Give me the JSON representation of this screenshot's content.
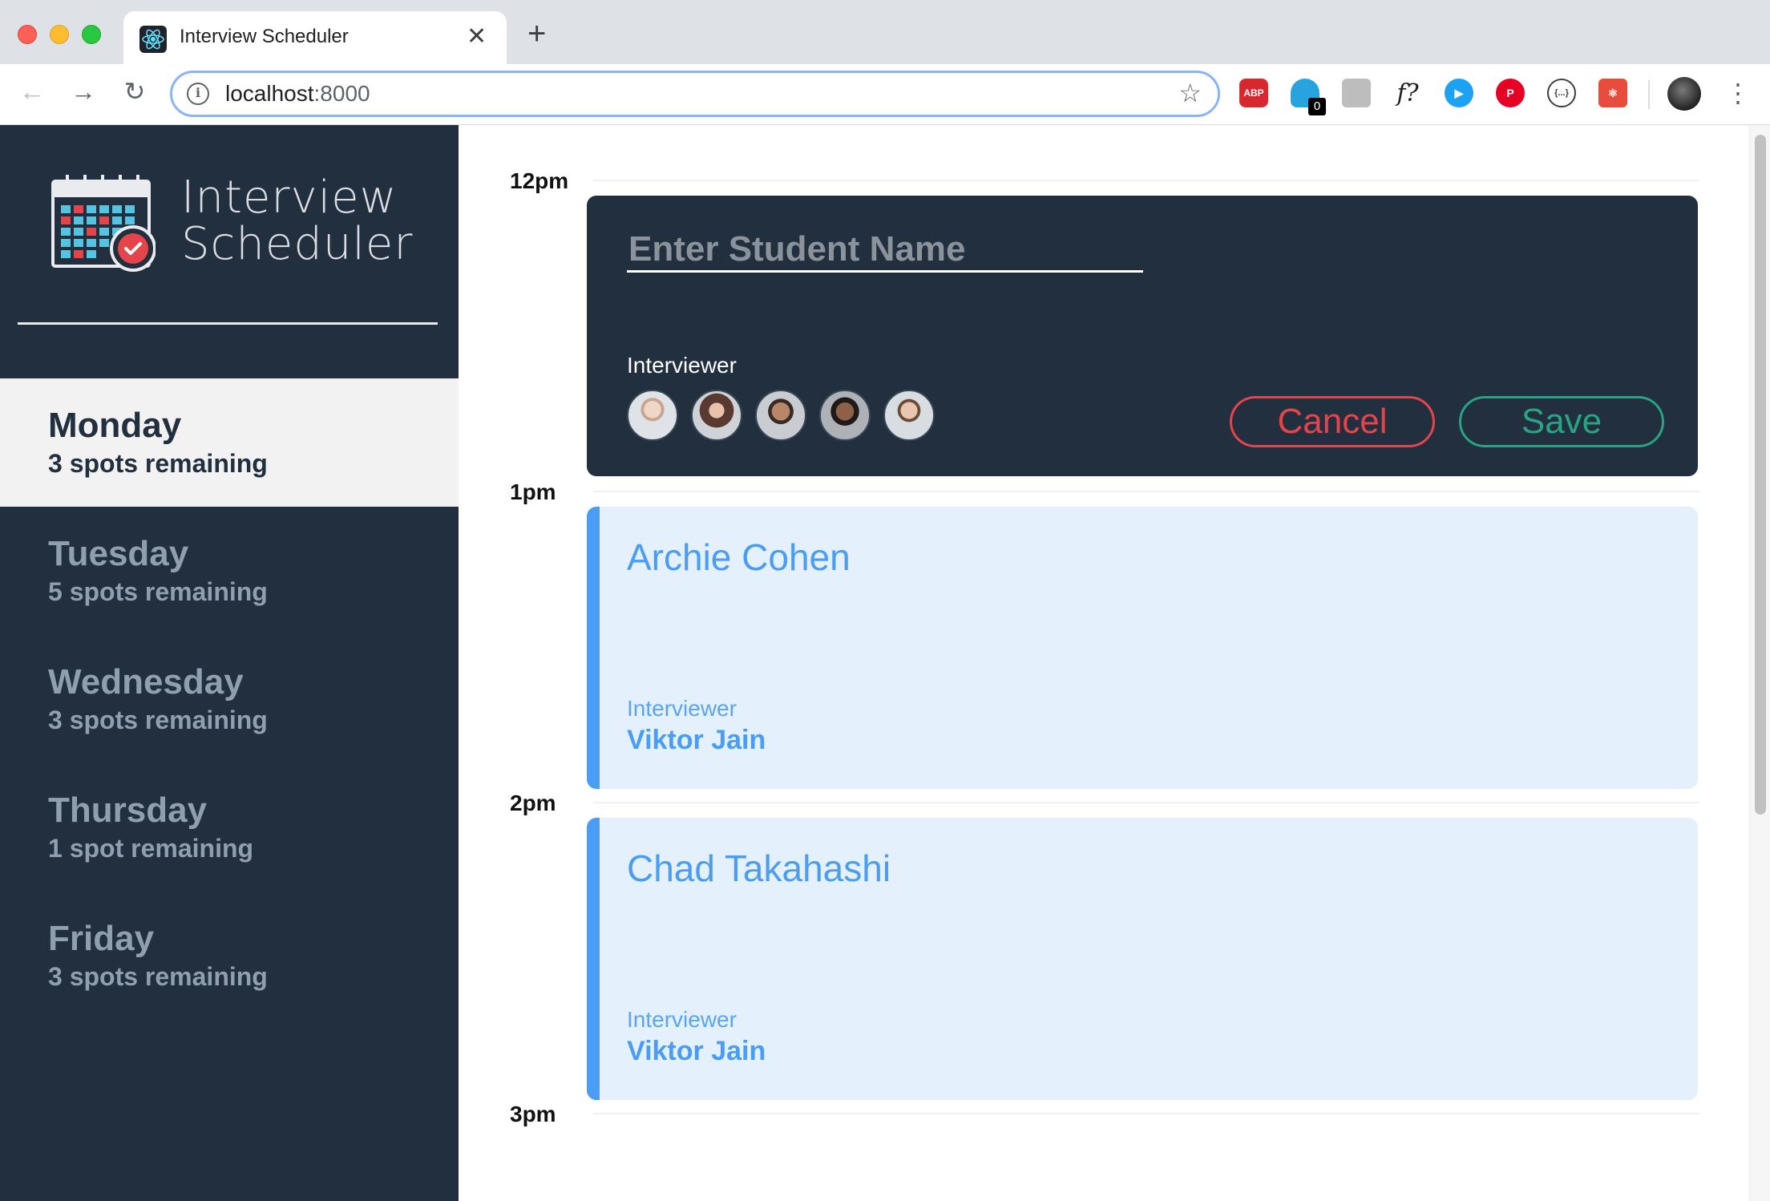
{
  "browser": {
    "tab_title": "Interview Scheduler",
    "url_host": "localhost",
    "url_port": ":8000",
    "extensions": [
      "ABP",
      "0",
      "f?"
    ]
  },
  "sidebar": {
    "logo_line1": "Interview",
    "logo_line2": "Scheduler",
    "days": [
      {
        "name": "Monday",
        "spots": "3 spots remaining",
        "selected": true
      },
      {
        "name": "Tuesday",
        "spots": "5 spots remaining",
        "selected": false
      },
      {
        "name": "Wednesday",
        "spots": "3 spots remaining",
        "selected": false
      },
      {
        "name": "Thursday",
        "spots": "1 spot remaining",
        "selected": false
      },
      {
        "name": "Friday",
        "spots": "3 spots remaining",
        "selected": false
      }
    ]
  },
  "schedule": {
    "hours": [
      "12pm",
      "1pm",
      "2pm",
      "3pm"
    ],
    "form": {
      "placeholder": "Enter Student Name",
      "interviewer_label": "Interviewer",
      "cancel_label": "Cancel",
      "save_label": "Save"
    },
    "appointments": [
      {
        "student": "Archie Cohen",
        "interviewer_label": "Interviewer",
        "interviewer": "Viktor Jain"
      },
      {
        "student": "Chad Takahashi",
        "interviewer_label": "Interviewer",
        "interviewer": "Viktor Jain"
      }
    ]
  },
  "colors": {
    "sidebar_bg": "#222f3e",
    "accent_blue": "#4a9df2",
    "cancel_red": "#e5454a",
    "save_green": "#27a483"
  }
}
